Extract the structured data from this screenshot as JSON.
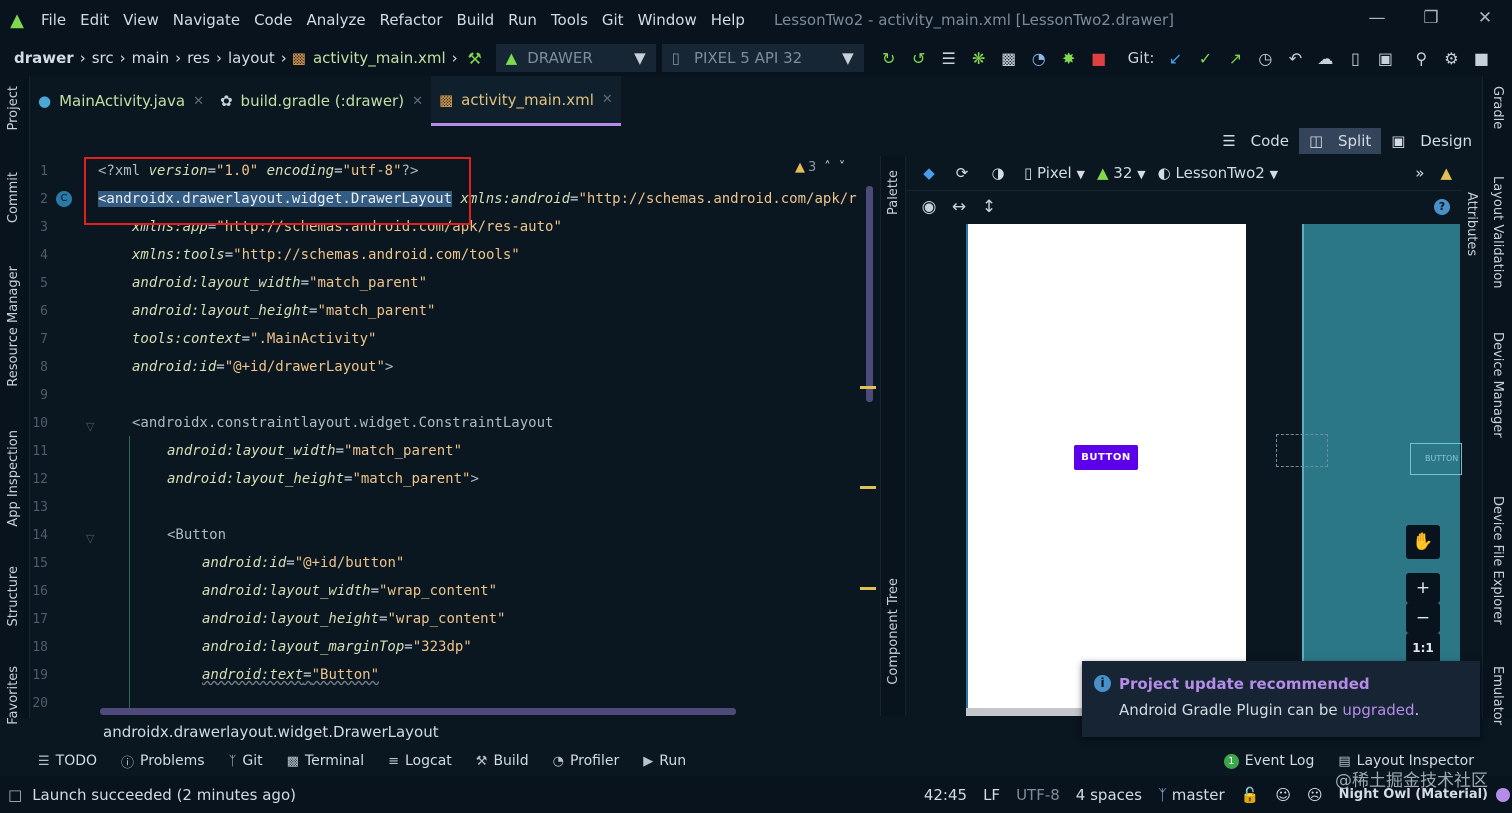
{
  "menu": {
    "app_icon": "android-icon",
    "items": [
      "File",
      "Edit",
      "View",
      "Navigate",
      "Code",
      "Analyze",
      "Refactor",
      "Build",
      "Run",
      "Tools",
      "Git",
      "Window",
      "Help"
    ],
    "window_title": "LessonTwo2 - activity_main.xml [LessonTwo2.drawer]",
    "window_controls": [
      "minimize-icon",
      "restore-icon",
      "close-icon"
    ]
  },
  "navbar": {
    "breadcrumbs": [
      "drawer",
      "src",
      "main",
      "res",
      "layout",
      "activity_main.xml"
    ],
    "run_config": "DRAWER",
    "device": "PIXEL 5 API 32",
    "git_label": "Git:"
  },
  "tabs": [
    {
      "label": "MainActivity.java",
      "icon": "class-icon"
    },
    {
      "label": "build.gradle (:drawer)",
      "icon": "gradle-icon"
    },
    {
      "label": "activity_main.xml",
      "icon": "layout-file-icon",
      "active": true
    }
  ],
  "view_modes": {
    "code": "Code",
    "split": "Split",
    "design": "Design",
    "selected": "Split"
  },
  "left_strip": [
    "Project",
    "Commit",
    "Resource Manager",
    "App Inspection",
    "Structure",
    "Favorites"
  ],
  "right_strip": [
    "Gradle",
    "Layout Validation",
    "Device Manager",
    "Device File Explorer",
    "Emulator"
  ],
  "editor": {
    "line_numbers": [
      "1",
      "2",
      "3",
      "4",
      "5",
      "6",
      "7",
      "8",
      "9",
      "10",
      "11",
      "12",
      "13",
      "14",
      "15",
      "16",
      "17",
      "18",
      "19",
      "20"
    ],
    "inspection_count": "3",
    "lines": {
      "l1": {
        "a": "<?xml ",
        "b": "version",
        "c": "=",
        "d": "\"1.0\"",
        "e": " ",
        "f": "encoding",
        "g": "=",
        "h": "\"utf-8\"",
        "i": "?>"
      },
      "l2": {
        "tag": "<androidx.drawerlayout.widget.DrawerLayout",
        "attr": " xmlns:android",
        "eq": "=",
        "val": "\"http://schemas.android.com/apk/r"
      },
      "l3": {
        "attr": "xmlns:app",
        "eq": "=",
        "val": "\"http://schemas.android.com/apk/res-auto\""
      },
      "l4": {
        "attr": "xmlns:tools",
        "eq": "=",
        "val": "\"http://schemas.android.com/tools\""
      },
      "l5": {
        "attr": "android:layout_width",
        "eq": "=",
        "val": "\"match_parent\""
      },
      "l6": {
        "attr": "android:layout_height",
        "eq": "=",
        "val": "\"match_parent\""
      },
      "l7": {
        "attr": "tools:context",
        "eq": "=",
        "val": "\".MainActivity\""
      },
      "l8": {
        "attr": "android:id",
        "eq": "=",
        "val": "\"@+id/drawerLayout\"",
        "end": ">"
      },
      "l10": {
        "tag": "<androidx.constraintlayout.widget.ConstraintLayout"
      },
      "l11": {
        "attr": "android:layout_width",
        "eq": "=",
        "val": "\"match_parent\""
      },
      "l12": {
        "attr": "android:layout_height",
        "eq": "=",
        "val": "\"match_parent\"",
        "end": ">"
      },
      "l14": {
        "tag": "<Button"
      },
      "l15": {
        "attr": "android:id",
        "eq": "=",
        "val": "\"@+id/button\""
      },
      "l16": {
        "attr": "android:layout_width",
        "eq": "=",
        "val": "\"wrap_content\""
      },
      "l17": {
        "attr": "android:layout_height",
        "eq": "=",
        "val": "\"wrap_content\""
      },
      "l18": {
        "attr": "android:layout_marginTop",
        "eq": "=",
        "val": "\"323dp\""
      },
      "l19": {
        "attr": "android:text",
        "eq": "=",
        "val": "\"Button\""
      }
    }
  },
  "palette_labels": {
    "palette": "Palette",
    "component_tree": "Component Tree",
    "attributes": "Attributes"
  },
  "design_toolbar": {
    "device": "Pixel",
    "api": "32",
    "theme": "LessonTwo2"
  },
  "preview": {
    "button_label": "BUTTON",
    "blueprint_button_label": "BUTTON",
    "button_color": "#5b00e8",
    "zoom_ratio": "1:1"
  },
  "notification": {
    "title": "Project update recommended",
    "body_prefix": "Android Gradle Plugin can be ",
    "link": "upgraded",
    "body_suffix": "."
  },
  "editor_breadcrumb": "androidx.drawerlayout.widget.DrawerLayout",
  "tool_windows": [
    {
      "label": "TODO",
      "icon": "list-icon"
    },
    {
      "label": "Problems",
      "icon": "info-icon"
    },
    {
      "label": "Git",
      "icon": "branch-icon"
    },
    {
      "label": "Terminal",
      "icon": "terminal-icon"
    },
    {
      "label": "Logcat",
      "icon": "logcat-icon"
    },
    {
      "label": "Build",
      "icon": "hammer-icon"
    },
    {
      "label": "Profiler",
      "icon": "gauge-icon"
    },
    {
      "label": "Run",
      "icon": "play-icon"
    }
  ],
  "tool_windows_right": [
    {
      "label": "Event Log",
      "badge": "1"
    },
    {
      "label": "Layout Inspector"
    }
  ],
  "status": {
    "message": "Launch succeeded (2 minutes ago)",
    "position": "42:45",
    "line_sep": "LF",
    "encoding": "UTF-8",
    "indent": "4 spaces",
    "branch": "master",
    "theme": "Night Owl (Material)"
  },
  "watermark": "@稀土掘金技术社区"
}
